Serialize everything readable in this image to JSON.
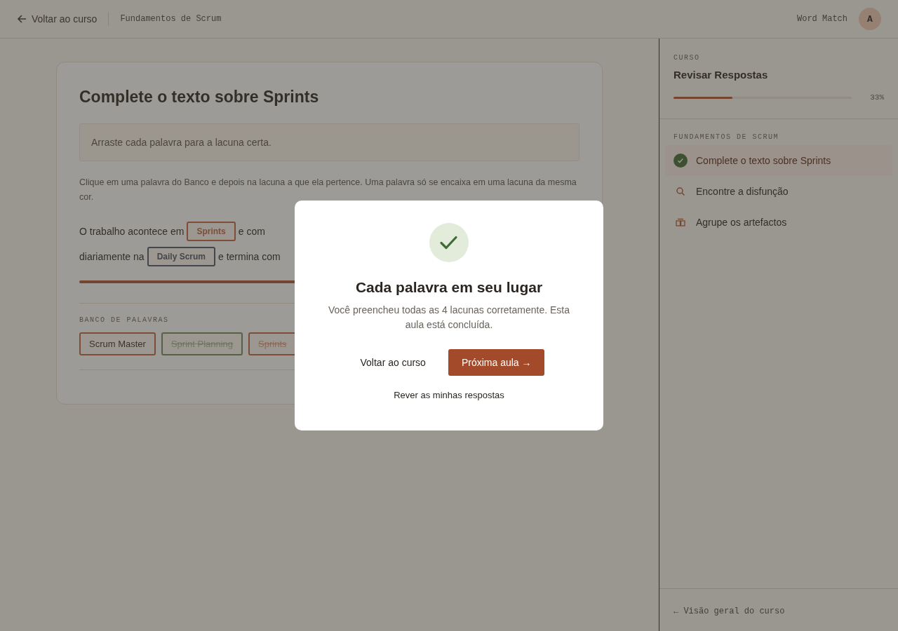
{
  "topbar": {
    "back_link": "Voltar ao curso",
    "course": "Fundamentos de Scrum",
    "app_name": "Word Match",
    "avatar": "A"
  },
  "lesson": {
    "title": "Complete o texto sobre Sprints",
    "instruction": "Arraste cada palavra para a lacuna certa.",
    "help": "Clique em uma palavra do Banco e depois na lacuna a que ela pertence. Uma palavra só se encaixa em uma lacuna da mesma cor.",
    "lines": [
      [
        {
          "kind": "text",
          "text": "O trabalho acontece em"
        },
        {
          "kind": "blank",
          "text": "Sprints",
          "color": "#7e4d37"
        },
        {
          "kind": "text",
          "text": "e com"
        }
      ],
      [
        {
          "kind": "text",
          "text": "diariamente na"
        },
        {
          "kind": "blank",
          "text": "Daily Scrum",
          "color": "#43464b"
        },
        {
          "kind": "text",
          "text": "e termina com"
        }
      ]
    ],
    "progress": {
      "level": 1
    },
    "bank_label": "BANCO DE PALAVRAS",
    "bank": [
      {
        "text": "Scrum Master",
        "used": false,
        "color": "#7e4d37"
      },
      {
        "text": "Sprint Planning",
        "used": true,
        "color": "#556147"
      },
      {
        "text": "Sprints",
        "used": true,
        "color": "#7e4d37"
      }
    ]
  },
  "sidebar": {
    "section": "CURSO",
    "title": "Revisar Respostas",
    "progress": {
      "level": 0.33
    },
    "percent": "33%",
    "group": "FUNDAMENTOS DE SCRUM",
    "items": [
      {
        "label": "Complete o texto sobre Sprints",
        "kind": "done",
        "selected": true
      },
      {
        "label": "Encontre a disfunção",
        "kind": "search",
        "selected": false
      },
      {
        "label": "Agrupe os artefactos",
        "kind": "group",
        "selected": false
      }
    ],
    "footer_link": "← Visão geral do curso"
  },
  "modal": {
    "title": "Cada palavra em seu lugar",
    "message": "Você preencheu todas as 4 lacunas corretamente. Esta aula está concluída.",
    "secondary": "Voltar ao curso",
    "primary": "Próxima aula →",
    "review": "Rever as minhas respostas"
  }
}
